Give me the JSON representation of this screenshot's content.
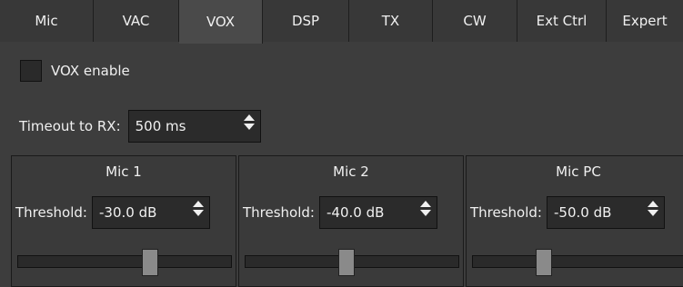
{
  "tabs": [
    {
      "label": "Mic"
    },
    {
      "label": "VAC"
    },
    {
      "label": "VOX",
      "active": true
    },
    {
      "label": "DSP"
    },
    {
      "label": "TX"
    },
    {
      "label": "CW"
    },
    {
      "label": "Ext Ctrl"
    },
    {
      "label": "Expert"
    }
  ],
  "vox_enable": {
    "label": "VOX enable",
    "checked": false
  },
  "timeout": {
    "label": "Timeout to RX:",
    "value": "500 ms"
  },
  "panels": [
    {
      "title": "Mic 1",
      "threshold_label": "Threshold:",
      "threshold_value": "-30.0 dB",
      "slider_fraction": 0.63
    },
    {
      "title": "Mic 2",
      "threshold_label": "Threshold:",
      "threshold_value": "-40.0 dB",
      "slider_fraction": 0.47
    },
    {
      "title": "Mic PC",
      "threshold_label": "Threshold:",
      "threshold_value": "-50.0 dB",
      "slider_fraction": 0.32
    }
  ]
}
